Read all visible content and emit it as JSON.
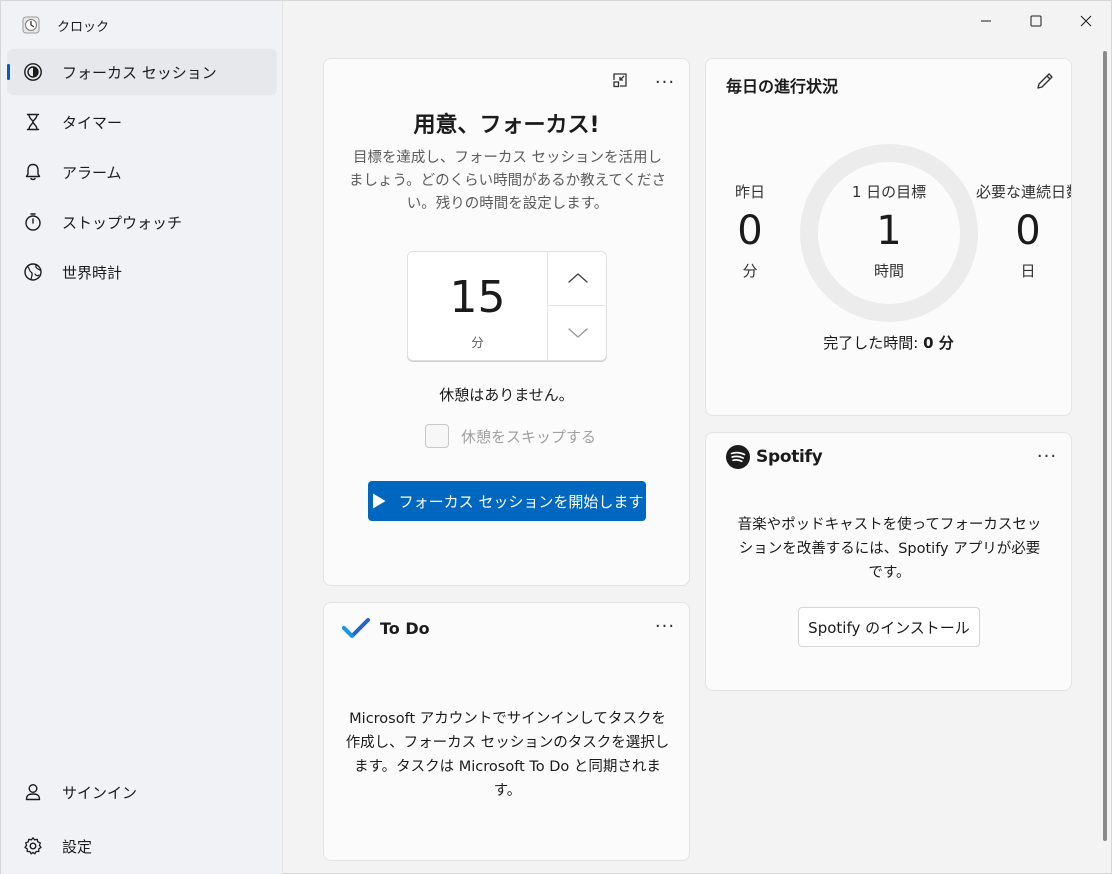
{
  "app": {
    "title": "クロック"
  },
  "sidebar": {
    "items": [
      {
        "label": "フォーカス セッション",
        "icon": "focus-icon",
        "active": true
      },
      {
        "label": "タイマー",
        "icon": "hourglass-icon"
      },
      {
        "label": "アラーム",
        "icon": "bell-icon"
      },
      {
        "label": "ストップウォッチ",
        "icon": "stopwatch-icon"
      },
      {
        "label": "世界時計",
        "icon": "globe-icon"
      }
    ],
    "bottom": [
      {
        "label": "サインイン",
        "icon": "person-icon"
      },
      {
        "label": "設定",
        "icon": "gear-icon"
      }
    ]
  },
  "focus": {
    "title": "用意、フォーカス!",
    "description": "目標を達成し、フォーカス セッションを活用しましょう。どのくらい時間があるか教えてください。残りの時間を設定します。",
    "minutes": "15",
    "unit": "分",
    "break_text": "休憩はありません。",
    "skip_label": "休憩をスキップする",
    "start_label": "フォーカス セッションを開始します"
  },
  "progress": {
    "title": "毎日の進行状況",
    "yesterday": {
      "label": "昨日",
      "value": "0",
      "unit": "分"
    },
    "goal": {
      "label": "1 日の目標",
      "value": "1",
      "unit": "時間"
    },
    "streak": {
      "label": "必要な連続日数",
      "value": "0",
      "unit": "日"
    },
    "completed_label": "完了した時間:",
    "completed_value": "0 分"
  },
  "spotify": {
    "brand": "Spotify",
    "description": "音楽やポッドキャストを使ってフォーカスセッションを改善するには、Spotify アプリが必要です。",
    "install_label": "Spotify のインストール"
  },
  "todo": {
    "title": "To Do",
    "description": "Microsoft アカウントでサインインしてタスクを作成し、フォーカス セッションのタスクを選択します。タスクは Microsoft To Do と同期されます。"
  },
  "colors": {
    "accent": "#0067c0",
    "active_indicator": "#005fb8",
    "spotify": "#1b1b1b",
    "todo_blue": "#2564cf"
  },
  "window_controls": [
    "minimize-icon",
    "maximize-icon",
    "close-icon"
  ]
}
